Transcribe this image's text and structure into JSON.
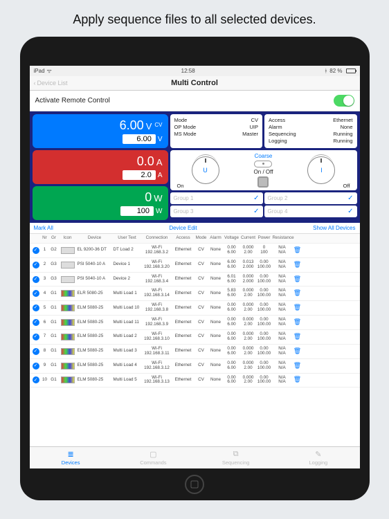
{
  "promo_caption": "Apply sequence files to all selected devices.",
  "status": {
    "carrier": "iPad",
    "time": "12:58",
    "battery": "82 %"
  },
  "nav": {
    "back": "Device List",
    "title": "Multi Control"
  },
  "arc": {
    "label": "Activate Remote Control",
    "on": true
  },
  "readouts": {
    "voltage": {
      "value": "6.00",
      "unit": "V",
      "tag": "CV",
      "set": "6.00",
      "set_unit": "V"
    },
    "current": {
      "value": "0.0",
      "unit": "A",
      "set": "2.0",
      "set_unit": "A"
    },
    "power": {
      "value": "0",
      "unit": "W",
      "set": "100",
      "set_unit": "W"
    }
  },
  "info1": {
    "Mode": "CV",
    "OP Mode": "UIP",
    "MS Mode": "Master"
  },
  "info2": {
    "Access": "Ethernet",
    "Alarm": "None",
    "Sequencing": "Running",
    "Logging": "Running"
  },
  "dials": {
    "left": "U",
    "right": "I",
    "mode": "Coarse",
    "toggle_label": "On / Off",
    "on": "On",
    "off": "Off"
  },
  "groups": [
    "Group 1",
    "Group 2",
    "Group 3",
    "Group 4"
  ],
  "table_controls": {
    "mark_all": "Mark All",
    "edit": "Device Edit",
    "show_all": "Show All Devices"
  },
  "columns": [
    "Nr",
    "Gr",
    "Icon",
    "Device",
    "User Text",
    "Connection",
    "Access",
    "Mode",
    "Alarm",
    "Voltage",
    "Current",
    "Power",
    "Resistance",
    ""
  ],
  "rows": [
    {
      "nr": "1",
      "gr": "G2",
      "icon": "plain",
      "device": "EL 9200-36 DT",
      "user": "DT Load 2",
      "conn_a": "Wi-Fi",
      "conn_b": "192.168.3.2",
      "access": "Ethernet",
      "mode": "CV",
      "alarm": "None",
      "v1": "0.00",
      "v2": "6.00",
      "c1": "0.000",
      "c2": "2.00",
      "p1": "0",
      "p2": "100",
      "r1": "N/A",
      "r2": "N/A"
    },
    {
      "nr": "2",
      "gr": "G3",
      "icon": "plain",
      "device": "PSI 5040-10 A",
      "user": "Device 1",
      "conn_a": "Wi-Fi",
      "conn_b": "192.168.3.20",
      "access": "Ethernet",
      "mode": "CV",
      "alarm": "None",
      "v1": "6.00",
      "v2": "6.00",
      "c1": "0.013",
      "c2": "2.000",
      "p1": "0.00",
      "p2": "100.00",
      "r1": "N/A",
      "r2": "N/A"
    },
    {
      "nr": "3",
      "gr": "G3",
      "icon": "plain",
      "device": "PSI 5040-10 A",
      "user": "Device 2",
      "conn_a": "Wi-Fi",
      "conn_b": "192.168.3.4",
      "access": "Ethernet",
      "mode": "CV",
      "alarm": "None",
      "v1": "6.01",
      "v2": "6.00",
      "c1": "0.000",
      "c2": "2.000",
      "p1": "0.00",
      "p2": "100.00",
      "r1": "N/A",
      "r2": "N/A"
    },
    {
      "nr": "4",
      "gr": "G1",
      "icon": "multi",
      "device": "ELR 5080-25",
      "user": "Multi Load 1",
      "conn_a": "Wi-Fi",
      "conn_b": "192.168.3.14",
      "access": "Ethernet",
      "mode": "CV",
      "alarm": "None",
      "v1": "5.83",
      "v2": "6.00",
      "c1": "0.000",
      "c2": "2.00",
      "p1": "0.00",
      "p2": "100.00",
      "r1": "N/A",
      "r2": "N/A"
    },
    {
      "nr": "5",
      "gr": "G1",
      "icon": "multi",
      "device": "ELM 5080-25",
      "user": "Multi Load 10",
      "conn_a": "Wi-Fi",
      "conn_b": "192.168.3.8",
      "access": "Ethernet",
      "mode": "CV",
      "alarm": "None",
      "v1": "0.00",
      "v2": "6.00",
      "c1": "0.000",
      "c2": "2.00",
      "p1": "0.00",
      "p2": "100.00",
      "r1": "N/A",
      "r2": "N/A"
    },
    {
      "nr": "6",
      "gr": "G1",
      "icon": "multi",
      "device": "ELM 5080-25",
      "user": "Multi Load 11",
      "conn_a": "Wi-Fi",
      "conn_b": "192.168.3.9",
      "access": "Ethernet",
      "mode": "CV",
      "alarm": "None",
      "v1": "0.00",
      "v2": "6.00",
      "c1": "0.000",
      "c2": "2.00",
      "p1": "0.00",
      "p2": "100.00",
      "r1": "N/A",
      "r2": "N/A"
    },
    {
      "nr": "7",
      "gr": "G1",
      "icon": "multi",
      "device": "ELM 5080-25",
      "user": "Multi Load 2",
      "conn_a": "Wi-Fi",
      "conn_b": "192.168.3.10",
      "access": "Ethernet",
      "mode": "CV",
      "alarm": "None",
      "v1": "0.00",
      "v2": "6.00",
      "c1": "0.000",
      "c2": "2.00",
      "p1": "0.00",
      "p2": "100.00",
      "r1": "N/A",
      "r2": "N/A"
    },
    {
      "nr": "8",
      "gr": "G1",
      "icon": "multi",
      "device": "ELM 5080-25",
      "user": "Multi Load 3",
      "conn_a": "Wi-Fi",
      "conn_b": "192.168.3.11",
      "access": "Ethernet",
      "mode": "CV",
      "alarm": "None",
      "v1": "0.00",
      "v2": "6.00",
      "c1": "0.000",
      "c2": "2.00",
      "p1": "0.00",
      "p2": "100.00",
      "r1": "N/A",
      "r2": "N/A"
    },
    {
      "nr": "9",
      "gr": "G1",
      "icon": "multi",
      "device": "ELM 5080-25",
      "user": "Multi Load 4",
      "conn_a": "Wi-Fi",
      "conn_b": "192.168.3.12",
      "access": "Ethernet",
      "mode": "CV",
      "alarm": "None",
      "v1": "0.00",
      "v2": "6.00",
      "c1": "0.000",
      "c2": "2.00",
      "p1": "0.00",
      "p2": "100.00",
      "r1": "N/A",
      "r2": "N/A"
    },
    {
      "nr": "10",
      "gr": "G1",
      "icon": "multi",
      "device": "ELM 5080-25",
      "user": "Multi Load 5",
      "conn_a": "Wi-Fi",
      "conn_b": "192.168.3.13",
      "access": "Ethernet",
      "mode": "CV",
      "alarm": "None",
      "v1": "0.00",
      "v2": "6.00",
      "c1": "0.000",
      "c2": "2.00",
      "p1": "0.00",
      "p2": "100.00",
      "r1": "N/A",
      "r2": "N/A"
    }
  ],
  "tabs": [
    {
      "label": "Devices",
      "icon": "≣",
      "active": true
    },
    {
      "label": "Commands",
      "icon": "▢",
      "active": false
    },
    {
      "label": "Sequencing",
      "icon": "⧉",
      "active": false
    },
    {
      "label": "Logging",
      "icon": "✎",
      "active": false
    }
  ]
}
